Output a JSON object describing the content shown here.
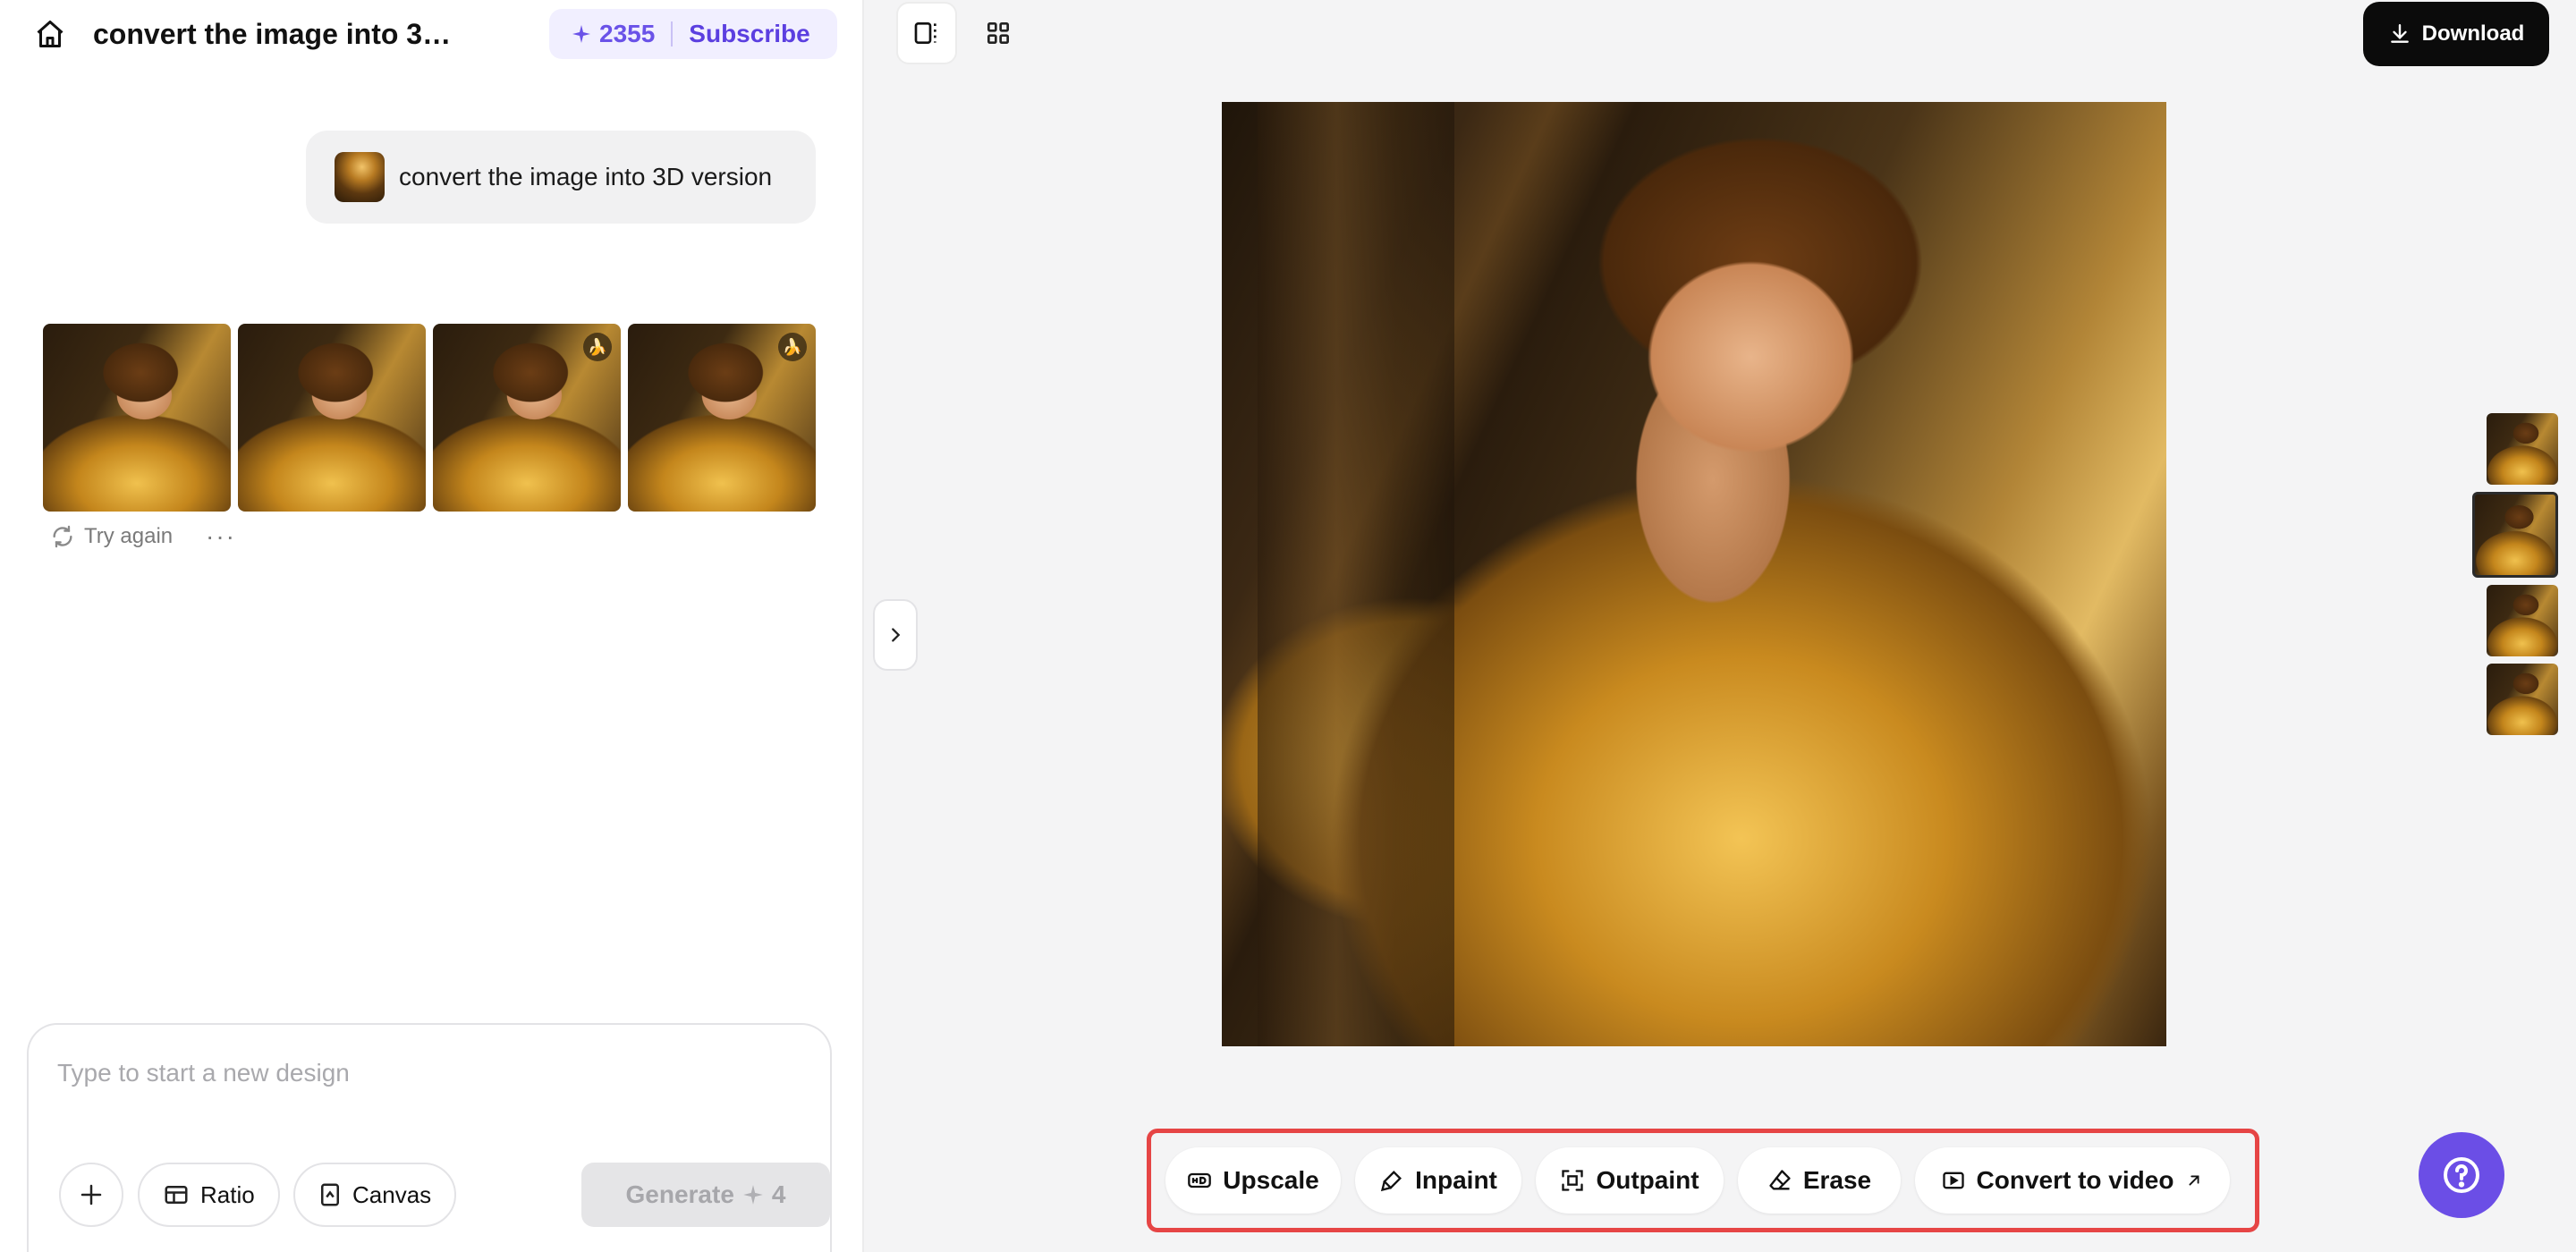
{
  "header": {
    "title": "convert the image into 3…",
    "credits": "2355",
    "subscribe_label": "Subscribe"
  },
  "chat": {
    "prompt_text": "convert the image into 3D version",
    "try_again_label": "Try again",
    "more_label": "···"
  },
  "composer": {
    "placeholder": "Type to start a new design",
    "ratio_label": "Ratio",
    "canvas_label": "Canvas",
    "generate_label": "Generate",
    "generate_cost": "4"
  },
  "toolbar": {
    "download_label": "Download"
  },
  "tools": {
    "upscale": "Upscale",
    "inpaint": "Inpaint",
    "outpaint": "Outpaint",
    "erase": "Erase",
    "convert_video": "Convert to video"
  },
  "icons": {
    "home": "home-icon",
    "spark": "sparkle-icon",
    "refresh": "refresh-icon",
    "plus": "plus-icon",
    "ratio": "ratio-icon",
    "canvas": "canvas-icon",
    "download": "download-icon",
    "chevron": "chevron-right-icon",
    "help": "help-icon"
  },
  "colors": {
    "accent": "#6b4ee6",
    "highlight_border": "#e64545",
    "download_bg": "#0b0b0b"
  }
}
